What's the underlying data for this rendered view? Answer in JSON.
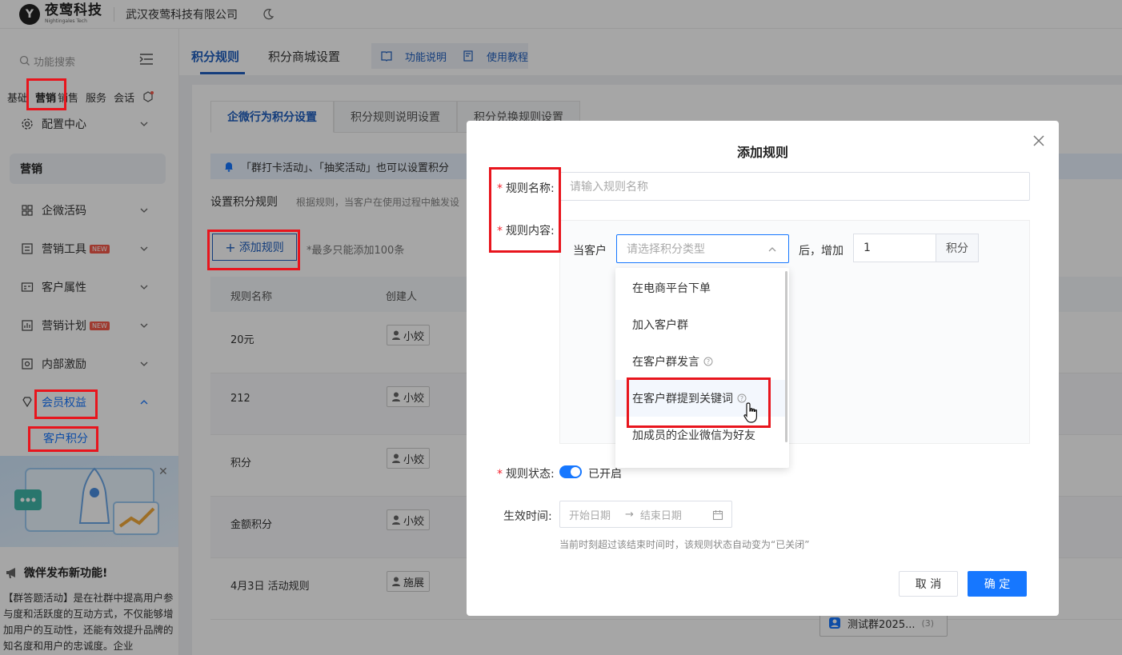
{
  "topbar": {
    "logo_cn": "夜莺科技",
    "logo_en": "Nightingales Tech",
    "company": "武汉夜莺科技有限公司"
  },
  "sidebar": {
    "search_placeholder": "功能搜索",
    "tabs": [
      "基础",
      "营销",
      "销售",
      "服务",
      "会话"
    ],
    "active_tab": "营销",
    "config_center": "配置中心",
    "section_title": "营销",
    "items": [
      {
        "label": "企微活码",
        "icon": "grid-icon"
      },
      {
        "label": "营销工具",
        "icon": "tool-icon",
        "badge": "NEW"
      },
      {
        "label": "客户属性",
        "icon": "id-card-icon"
      },
      {
        "label": "营销计划",
        "icon": "chart-icon",
        "badge": "NEW"
      },
      {
        "label": "内部激励",
        "icon": "gift-icon"
      },
      {
        "label": "会员权益",
        "icon": "diamond-icon"
      }
    ],
    "sub_item": "客户积分",
    "promo": {
      "title": "微伴发布新功能!",
      "text": "【群答题活动】是在社群中提高用户参与度和活跃度的互动方式，不仅能够增加用户的互动性，还能有效提升品牌的知名度和用户的忠诚度。企业"
    }
  },
  "main": {
    "tabs": [
      "积分规则",
      "积分商城设置"
    ],
    "active_tab": "积分规则",
    "help": {
      "guide": "功能说明",
      "tutorial": "使用教程"
    },
    "subtabs": [
      "企微行为积分设置",
      "积分规则说明设置",
      "积分兑换规则设置"
    ],
    "active_subtab": "企微行为积分设置",
    "notice": "「群打卡活动」、「抽奖活动」也可以设置积分",
    "set_title": "设置积分规则",
    "set_desc": "根据规则，当客户在使用过程中触发设",
    "add_button": "添加规则",
    "add_hint": "*最多只能添加100条",
    "table": {
      "headers": [
        "规则名称",
        "创建人"
      ],
      "rows": [
        {
          "name": "20元",
          "creator": "小姣"
        },
        {
          "name": "212",
          "creator": "小姣"
        },
        {
          "name": "积分",
          "creator": "小姣"
        },
        {
          "name": "金额积分",
          "creator": "小姣"
        },
        {
          "name": "4月3日 活动规则",
          "creator": "施展"
        }
      ]
    },
    "group_tag": {
      "name": "测试群2025...",
      "count": "(3)"
    }
  },
  "modal": {
    "title": "添加规则",
    "name_label": "规则名称:",
    "name_placeholder": "请输入规则名称",
    "content_label": "规则内容:",
    "when_customer": "当客户",
    "type_placeholder": "请选择积分类型",
    "after_add": "后，增加",
    "points_value": "1",
    "points_unit": "积分",
    "dropdown": [
      {
        "label": "在电商平台下单",
        "help": false
      },
      {
        "label": "加入客户群",
        "help": false
      },
      {
        "label": "在客户群发言",
        "help": true
      },
      {
        "label": "在客户群提到关键词",
        "help": true
      },
      {
        "label": "加成员的企业微信为好友",
        "help": false
      }
    ],
    "status_label": "规则状态:",
    "status_text": "已开启",
    "time_label": "生效时间:",
    "start_placeholder": "开始日期",
    "end_placeholder": "结束日期",
    "date_hint": "当前时刻超过该结束时间时，该规则状态自动变为“已关闭”",
    "cancel": "取 消",
    "ok": "确 定"
  },
  "colors": {
    "primary": "#1677ff",
    "brand_blue": "#1f5fbf",
    "highlight": "#e8151d",
    "required": "#f5222d"
  }
}
